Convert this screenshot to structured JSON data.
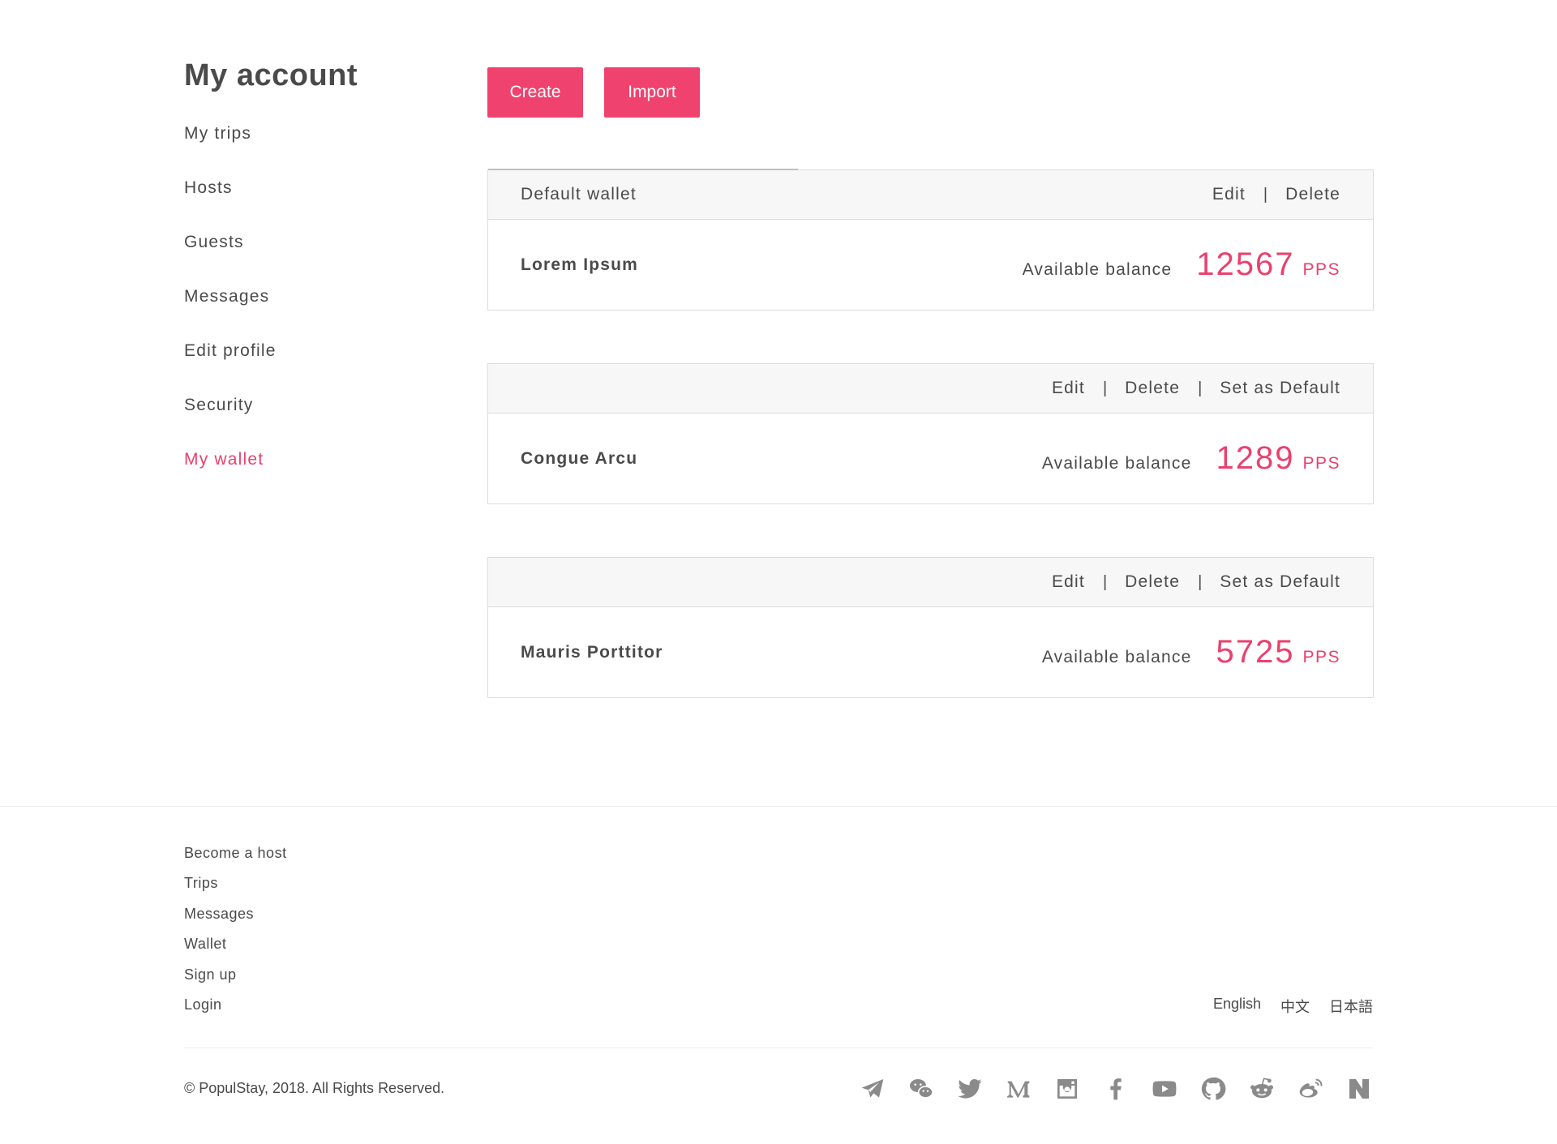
{
  "sidebar": {
    "title": "My account",
    "items": [
      {
        "label": "My trips"
      },
      {
        "label": "Hosts"
      },
      {
        "label": "Guests"
      },
      {
        "label": "Messages"
      },
      {
        "label": "Edit profile"
      },
      {
        "label": "Security"
      },
      {
        "label": "My wallet",
        "active": true
      }
    ]
  },
  "toolbar": {
    "create_label": "Create",
    "import_label": "Import"
  },
  "actions": {
    "edit": "Edit",
    "delete": "Delete",
    "set_default": "Set as Default",
    "separator": "|"
  },
  "wallets": [
    {
      "header_label": "Default wallet",
      "name": "Lorem Ipsum",
      "balance_label": "Available balance",
      "balance": "12567",
      "unit": "PPS"
    },
    {
      "header_label": "",
      "name": "Congue Arcu",
      "balance_label": "Available balance",
      "balance": "1289",
      "unit": "PPS"
    },
    {
      "header_label": "",
      "name": "Mauris Porttitor",
      "balance_label": "Available balance",
      "balance": "5725",
      "unit": "PPS"
    }
  ],
  "footer": {
    "links": [
      {
        "label": "Become a host"
      },
      {
        "label": "Trips"
      },
      {
        "label": "Messages"
      },
      {
        "label": "Wallet"
      },
      {
        "label": "Sign up"
      },
      {
        "label": "Login"
      }
    ],
    "languages": [
      "English",
      "中文",
      "日本語"
    ],
    "copyright": "© PopulStay, 2018. All Rights Reserved.",
    "social_icons": [
      "telegram-icon",
      "wechat-icon",
      "twitter-icon",
      "medium-icon",
      "instagram-icon",
      "facebook-icon",
      "youtube-icon",
      "github-icon",
      "reddit-icon",
      "weibo-icon",
      "naver-icon"
    ]
  },
  "colors": {
    "accent": "#f0426e",
    "text": "#4a4a4a",
    "icon": "#8a8a8a",
    "panel_bg": "#f7f7f7",
    "border": "#dcdcdc"
  }
}
